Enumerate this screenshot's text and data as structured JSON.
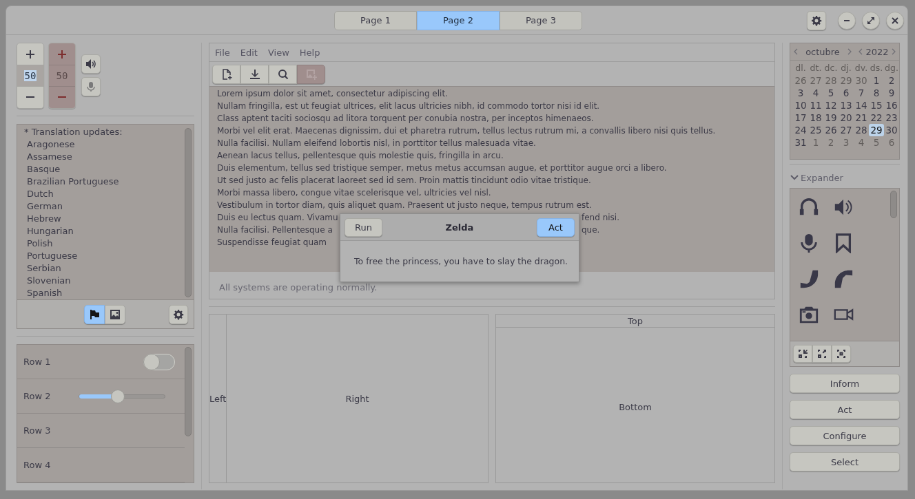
{
  "tabs": [
    {
      "label": "Page 1",
      "selected": false
    },
    {
      "label": "Page 2",
      "selected": true
    },
    {
      "label": "Page 3",
      "selected": false
    }
  ],
  "spin_buttons": [
    {
      "value": "50",
      "disabled": false
    },
    {
      "value": "50",
      "disabled": true
    }
  ],
  "audio_buttons": [
    {
      "kind": "speaker",
      "disabled": false
    },
    {
      "kind": "microphone",
      "disabled": true
    }
  ],
  "translation_list": {
    "header": "* Translation updates:",
    "items": [
      "Aragonese",
      "Assamese",
      "Basque",
      "Brazilian Portuguese",
      "Dutch",
      "German",
      "Hebrew",
      "Hungarian",
      "Polish",
      "Portuguese",
      "Serbian",
      "Slovenian",
      "Spanish"
    ]
  },
  "list_toolbar": [
    {
      "kind": "flag",
      "selected": true
    },
    {
      "kind": "image",
      "selected": false
    }
  ],
  "rows": [
    {
      "label": "Row 1",
      "kind": "switch",
      "on": false
    },
    {
      "label": "Row 2",
      "kind": "slider",
      "level": 0.45
    },
    {
      "label": "Row 3",
      "kind": "plain"
    },
    {
      "label": "Row 4",
      "kind": "plain"
    }
  ],
  "menu": [
    "File",
    "Edit",
    "View",
    "Help"
  ],
  "toolbar": [
    {
      "kind": "new",
      "disabled": false
    },
    {
      "kind": "download",
      "disabled": false
    },
    {
      "kind": "search",
      "disabled": false
    },
    {
      "kind": "image-add",
      "disabled": true
    }
  ],
  "text_lines": [
    {
      "text": "Lorem ipsum dolor sit amet, consectetur adipiscing elit."
    },
    {
      "text": "Nullam fringilla, est ut feugiat ultrices, elit lacus ultricies nibh, id commodo tortor nisi id elit."
    },
    {
      "text": "Class aptent taciti sociosqu ad litora torquent per conubia nostra, per inceptos himenaeos."
    },
    {
      "text": "Morbi vel elit erat. Maecenas dignissim, dui et pharetra rutrum, tellus lectus rutrum mi, a convallis libero nisi quis tellus."
    },
    {
      "text": "Nulla facilisi. Nullam eleifend lobortis nisl, in porttitor tellus malesuada vitae."
    },
    {
      "text": "Aenean lacus tellus, pellentesque quis molestie quis, fringilla in arcu."
    },
    {
      "text": "Duis elementum, tellus sed tristique semper, metus metus accumsan augue, et porttitor augue orci a libero."
    },
    {
      "text": "Ut sed justo ac felis placerat laoreet sed id sem. Proin mattis tincidunt odio vitae tristique."
    },
    {
      "text": "Morbi massa libero, congue vitae scelerisque vel, ultricies vel nisl."
    },
    {
      "text": "Vestibulum in tortor diam, quis aliquet quam. Praesent ut justo neque, tempus rutrum est."
    },
    {
      "text": "Duis eu lectus quam. Vivamu",
      "tail": "fend nisi."
    },
    {
      "text": "Nulla facilisi. Pellentesque a",
      "tail": "que."
    },
    {
      "text": "Suspendisse feugiat quam"
    }
  ],
  "status": "All systems are operating normally.",
  "paned": {
    "left": "Left",
    "right": "Right"
  },
  "frame": {
    "top": "Top",
    "bottom": "Bottom"
  },
  "calendar": {
    "month": "octubre",
    "year": "2022",
    "weekdays": [
      "dl.",
      "dt.",
      "dc.",
      "dj.",
      "dv.",
      "ds.",
      "dg."
    ],
    "days": [
      {
        "day": "26",
        "other": true,
        "selected": false
      },
      {
        "day": "27",
        "other": true,
        "selected": false
      },
      {
        "day": "28",
        "other": true,
        "selected": false
      },
      {
        "day": "29",
        "other": true,
        "selected": false
      },
      {
        "day": "30",
        "other": true,
        "selected": false
      },
      {
        "day": "1",
        "other": false,
        "selected": false
      },
      {
        "day": "2",
        "other": false,
        "selected": false
      },
      {
        "day": "3",
        "other": false,
        "selected": false
      },
      {
        "day": "4",
        "other": false,
        "selected": false
      },
      {
        "day": "5",
        "other": false,
        "selected": false
      },
      {
        "day": "6",
        "other": false,
        "selected": false
      },
      {
        "day": "7",
        "other": false,
        "selected": false
      },
      {
        "day": "8",
        "other": false,
        "selected": false
      },
      {
        "day": "9",
        "other": false,
        "selected": false
      },
      {
        "day": "10",
        "other": false,
        "selected": false
      },
      {
        "day": "11",
        "other": false,
        "selected": false
      },
      {
        "day": "12",
        "other": false,
        "selected": false
      },
      {
        "day": "13",
        "other": false,
        "selected": false
      },
      {
        "day": "14",
        "other": false,
        "selected": false
      },
      {
        "day": "15",
        "other": false,
        "selected": false
      },
      {
        "day": "16",
        "other": false,
        "selected": false
      },
      {
        "day": "17",
        "other": false,
        "selected": false
      },
      {
        "day": "18",
        "other": false,
        "selected": false
      },
      {
        "day": "19",
        "other": false,
        "selected": false
      },
      {
        "day": "20",
        "other": false,
        "selected": false
      },
      {
        "day": "21",
        "other": false,
        "selected": false
      },
      {
        "day": "22",
        "other": false,
        "selected": false
      },
      {
        "day": "23",
        "other": false,
        "selected": false
      },
      {
        "day": "24",
        "other": false,
        "selected": false
      },
      {
        "day": "25",
        "other": false,
        "selected": false
      },
      {
        "day": "26",
        "other": false,
        "selected": false
      },
      {
        "day": "27",
        "other": false,
        "selected": false
      },
      {
        "day": "28",
        "other": false,
        "selected": false
      },
      {
        "day": "29",
        "other": false,
        "selected": true
      },
      {
        "day": "30",
        "other": false,
        "selected": false
      },
      {
        "day": "31",
        "other": false,
        "selected": false
      },
      {
        "day": "1",
        "other": true,
        "selected": false
      },
      {
        "day": "2",
        "other": true,
        "selected": false
      },
      {
        "day": "3",
        "other": true,
        "selected": false
      },
      {
        "day": "4",
        "other": true,
        "selected": false
      },
      {
        "day": "5",
        "other": true,
        "selected": false
      },
      {
        "day": "6",
        "other": true,
        "selected": false
      }
    ]
  },
  "expander": {
    "label": "Expander",
    "expanded": true
  },
  "buttons": [
    "Inform",
    "Act",
    "Configure",
    "Select"
  ],
  "dialog": {
    "title": "Zelda",
    "buttons": [
      {
        "label": "Run",
        "suggested": false
      },
      {
        "label": "Act",
        "suggested": true
      }
    ],
    "message": "To free the princess, you have to slay the dragon."
  }
}
